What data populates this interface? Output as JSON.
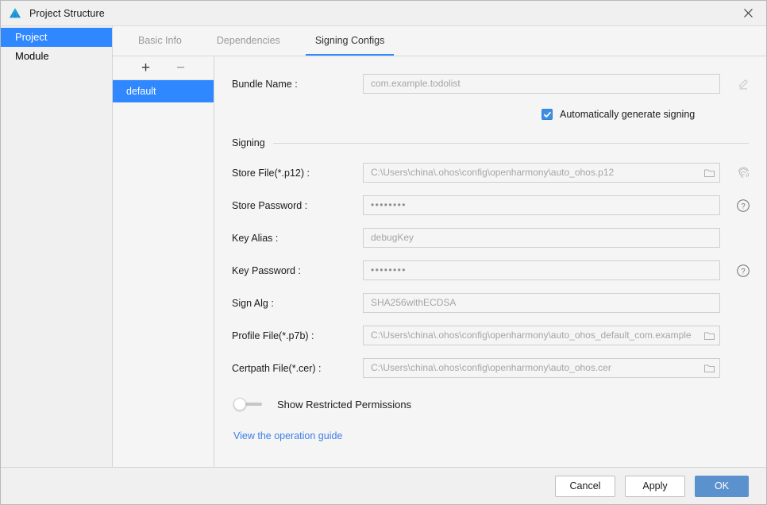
{
  "window": {
    "title": "Project Structure",
    "logo_icon": "deveco-logo-icon",
    "close_icon": "close-icon"
  },
  "leftnav": {
    "items": [
      {
        "label": "Project",
        "selected": true
      },
      {
        "label": "Module",
        "selected": false
      }
    ]
  },
  "tabs": [
    {
      "label": "Basic Info",
      "active": false
    },
    {
      "label": "Dependencies",
      "active": false
    },
    {
      "label": "Signing Configs",
      "active": true
    }
  ],
  "config_list": {
    "add_label": "+",
    "remove_label": "−",
    "items": [
      {
        "label": "default",
        "selected": true
      }
    ]
  },
  "form": {
    "bundle_name": {
      "label": "Bundle Name :",
      "value": "com.example.todolist",
      "edit_icon": "pencil-icon"
    },
    "auto_signing": {
      "label": "Automatically generate signing",
      "checked": true
    },
    "section_title": "Signing",
    "store_file": {
      "label": "Store File(*.p12) :",
      "value": "C:\\Users\\china\\.ohos\\config\\openharmony\\auto_ohos.p12",
      "browse_icon": "folder-icon",
      "side_icon": "fingerprint-icon"
    },
    "store_password": {
      "label": "Store Password :",
      "value": "••••••••",
      "side_icon": "help-icon"
    },
    "key_alias": {
      "label": "Key Alias :",
      "value": "debugKey"
    },
    "key_password": {
      "label": "Key Password :",
      "value": "••••••••",
      "side_icon": "help-icon"
    },
    "sign_alg": {
      "label": "Sign Alg :",
      "value": "SHA256withECDSA"
    },
    "profile_file": {
      "label": "Profile File(*.p7b) :",
      "value": "C:\\Users\\china\\.ohos\\config\\openharmony\\auto_ohos_default_com.example",
      "browse_icon": "folder-icon"
    },
    "certpath_file": {
      "label": "Certpath File(*.cer) :",
      "value": "C:\\Users\\china\\.ohos\\config\\openharmony\\auto_ohos.cer",
      "browse_icon": "folder-icon"
    },
    "restricted_permissions": {
      "label": "Show Restricted Permissions",
      "enabled": false
    },
    "guide_link": "View the operation guide"
  },
  "footer": {
    "cancel": "Cancel",
    "apply": "Apply",
    "ok": "OK"
  },
  "colors": {
    "accent_blue": "#2f88ff",
    "primary_button": "#5b92cd",
    "checkbox_blue": "#3d8fe3",
    "link_blue": "#3d7ee8",
    "panel_bg": "#f5f5f5",
    "chrome_bg": "#f0f0f0"
  }
}
